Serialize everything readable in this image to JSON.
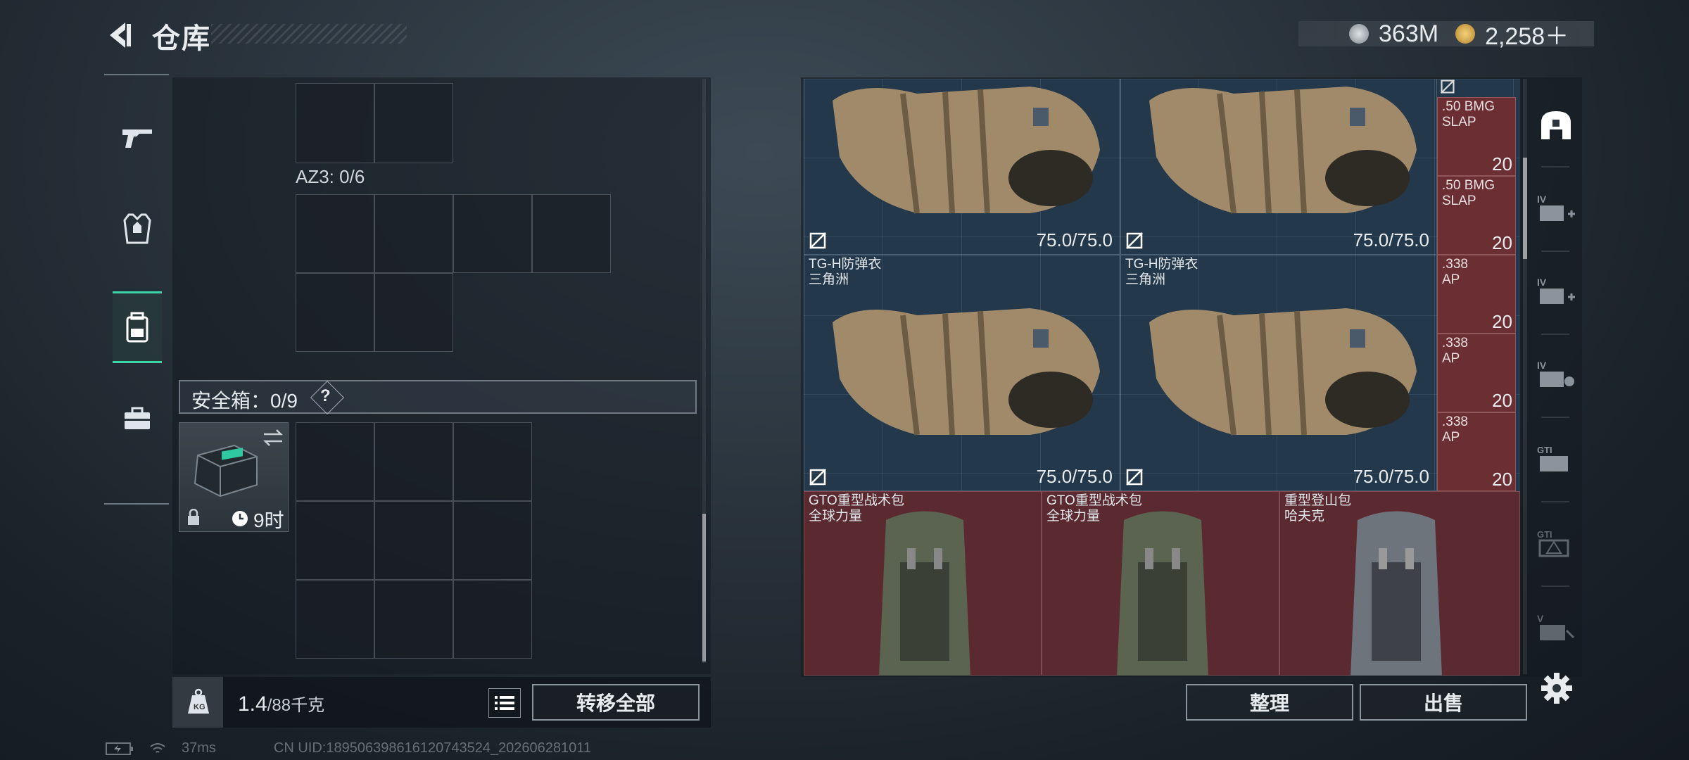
{
  "header": {
    "title": "仓库",
    "currency": [
      {
        "icon": "silver-coin-icon",
        "value": "363M"
      },
      {
        "icon": "gold-coin-icon",
        "value": "2,258＋"
      }
    ]
  },
  "left_nav": [
    {
      "icon": "gun-icon"
    },
    {
      "icon": "armor-vest-icon"
    },
    {
      "icon": "backpack-icon",
      "active": true
    },
    {
      "icon": "toolbox-icon"
    }
  ],
  "containers": {
    "az3_label": "AZ3: 0/6",
    "safe_label": "安全箱：0/9",
    "help": "?",
    "safebox_time": "9时"
  },
  "bottom": {
    "weight_current": "1.4",
    "weight_max": "/88千克",
    "transfer_all": "转移全部"
  },
  "stash": {
    "vests": [
      {
        "name": "",
        "maker": "",
        "durability": "75.0/75.0"
      },
      {
        "name": "",
        "maker": "",
        "durability": "75.0/75.0"
      },
      {
        "name": "TG-H防弹衣",
        "maker": "三角洲",
        "durability": "75.0/75.0"
      },
      {
        "name": "TG-H防弹衣",
        "maker": "三角洲",
        "durability": "75.0/75.0"
      }
    ],
    "ammo": [
      {
        "name": ".50 BMG SLAP",
        "qty": "20"
      },
      {
        "name": ".50 BMG SLAP",
        "qty": "20"
      },
      {
        "name": ".338 AP",
        "qty": "20"
      },
      {
        "name": ".338 AP",
        "qty": "20"
      },
      {
        "name": ".338 AP",
        "qty": "20"
      }
    ],
    "packs": [
      {
        "name": "GTO重型战术包",
        "maker": "全球力量"
      },
      {
        "name": "GTO重型战术包",
        "maker": "全球力量"
      },
      {
        "name": "重型登山包",
        "maker": "哈夫克"
      }
    ]
  },
  "right_tabs": [
    {
      "icon": "helmet-filter-icon",
      "label": ""
    },
    {
      "icon": "armor-iv-plus-icon",
      "label": "IV"
    },
    {
      "icon": "armor-iv-plus-2-icon",
      "label": "IV"
    },
    {
      "icon": "armor-iv-shield-icon",
      "label": "IV"
    },
    {
      "icon": "chest-rig-gt-icon",
      "label": "GTI"
    },
    {
      "icon": "rig-warning-icon",
      "label": "GTI"
    },
    {
      "icon": "backpack-v-icon",
      "label": "V"
    }
  ],
  "footer": {
    "sort": "整理",
    "sell": "出售"
  },
  "status": {
    "ping": "37ms",
    "uid": "CN UID:18950639861612074352​4_202606281011"
  }
}
